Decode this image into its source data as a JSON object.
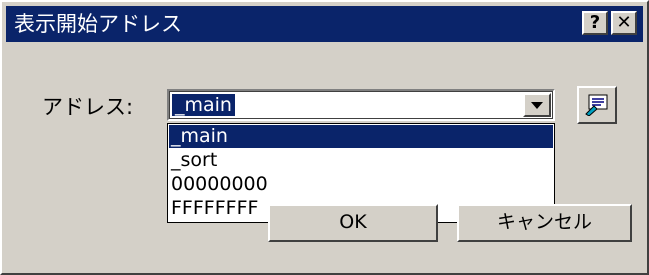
{
  "window": {
    "title": "表示開始アドレス",
    "help_label": "?",
    "close_label": "✕"
  },
  "form": {
    "address_label": "アドレス:",
    "selected_value": "_main",
    "dropdown_options": [
      "_main",
      "_sort",
      "00000000",
      "FFFFFFFF"
    ],
    "selected_index": 0
  },
  "buttons": {
    "ok_label": "OK",
    "cancel_label": "キャンセル"
  },
  "colors": {
    "title_bar": "#0a246a",
    "face": "#d4d0c8",
    "highlight": "#0a246a"
  },
  "icons": {
    "browse": "browse-symbol-icon",
    "dropdown": "chevron-down-icon"
  }
}
